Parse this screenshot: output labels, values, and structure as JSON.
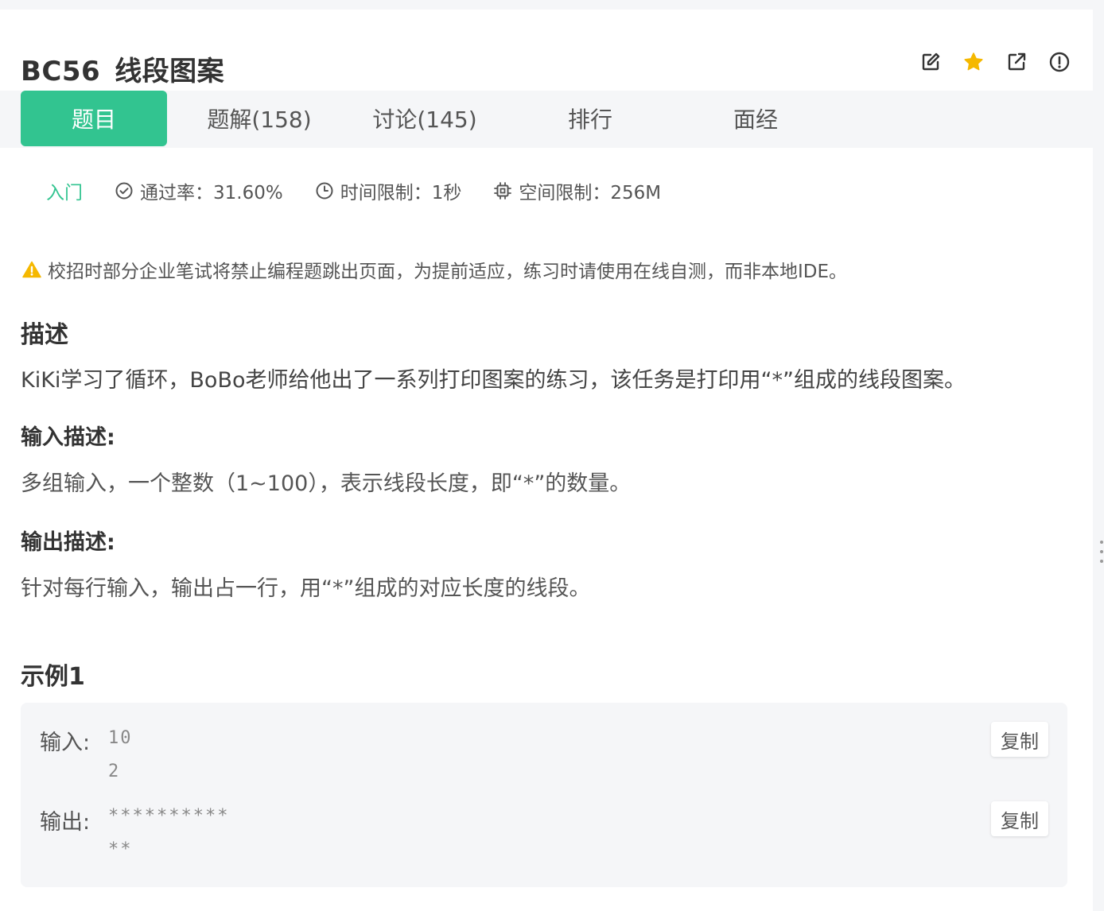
{
  "header": {
    "code": "BC56",
    "title": "线段图案"
  },
  "icons": {
    "edit": "edit-icon",
    "star": "star-icon",
    "share": "share-icon",
    "report": "report-icon",
    "accent": "#32c490",
    "star_color": "#f5b800"
  },
  "tabs": [
    {
      "label": "题目",
      "active": true
    },
    {
      "label": "题解(158)",
      "active": false
    },
    {
      "label": "讨论(145)",
      "active": false
    },
    {
      "label": "排行",
      "active": false
    },
    {
      "label": "面经",
      "active": false
    }
  ],
  "meta": {
    "level": "入门",
    "pass_rate": "通过率：31.60%",
    "time_limit": "时间限制：1秒",
    "space_limit": "空间限制：256M"
  },
  "notice": "校招时部分企业笔试将禁止编程题跳出页面，为提前适应，练习时请使用在线自测，而非本地IDE。",
  "description": {
    "heading": "描述",
    "text": "KiKi学习了循环，BoBo老师给他出了一系列打印图案的练习，该任务是打印用“*”组成的线段图案。"
  },
  "input_desc": {
    "heading": "输入描述:",
    "text": "多组输入，一个整数（1~100），表示线段长度，即“*”的数量。"
  },
  "output_desc": {
    "heading": "输出描述:",
    "text": "针对每行输入，输出占一行，用“*”组成的对应长度的线段。"
  },
  "example": {
    "heading": "示例1",
    "input_label": "输入:",
    "input": "10\n2",
    "output_label": "输出:",
    "output": "**********\n**",
    "copy_label": "复制"
  }
}
